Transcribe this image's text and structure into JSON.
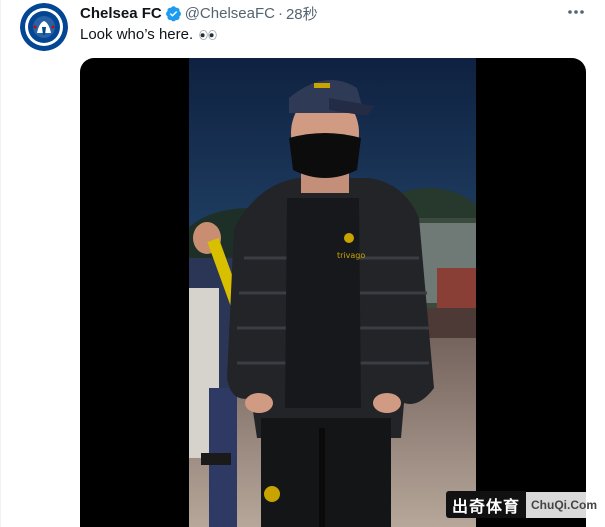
{
  "tweet": {
    "author_name": "Chelsea FC",
    "handle": "@ChelseaFC",
    "separator": "·",
    "time": "28秒",
    "text": "Look who’s here.",
    "emoji_icon": "eyes-emoji-icon",
    "verified_icon": "verified-badge-icon",
    "more_icon": "more-options-icon"
  },
  "watermark": {
    "brand_cn": "出奇体育",
    "brand_en": "ChuQi.Com"
  },
  "colors": {
    "verified": "#1d9bf0",
    "text": "#0f1419",
    "secondary": "#536471",
    "chelsea_blue": "#034694"
  }
}
